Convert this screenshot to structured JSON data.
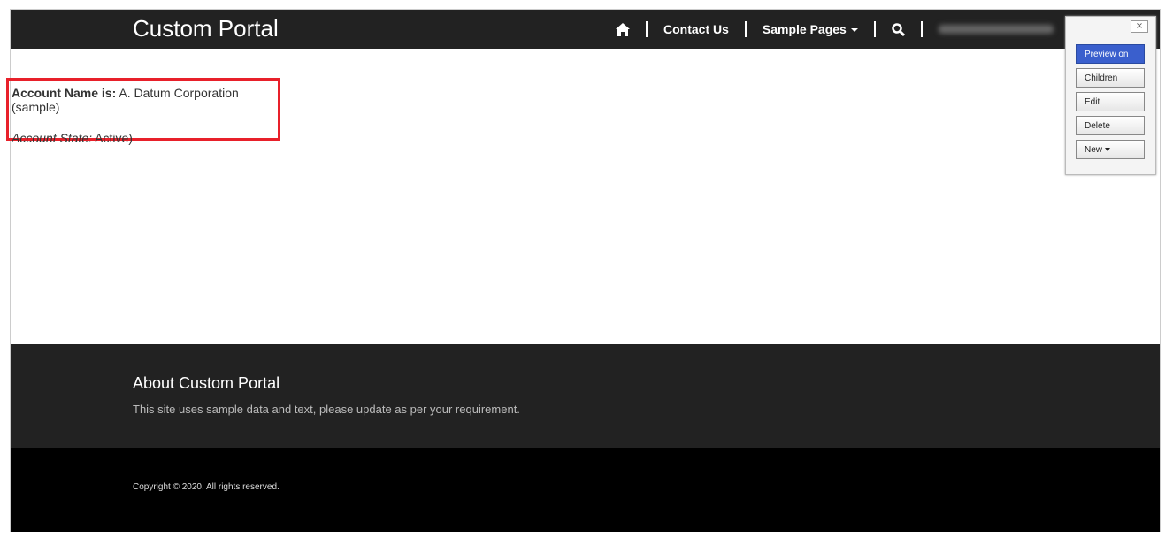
{
  "header": {
    "brand": "Custom Portal",
    "nav": {
      "home_icon": "home-icon",
      "contact": "Contact Us",
      "sample_pages": "Sample Pages",
      "search_icon": "search-icon"
    }
  },
  "content": {
    "account_name_label": "Account Name is:",
    "account_name_value": " A. Datum Corporation (sample)",
    "account_state_label": "Account State:",
    "account_state_value": " Active)",
    "highlight_color": "#e8202a"
  },
  "footer": {
    "title": "About Custom Portal",
    "text": "This site uses sample data and text, please update as per your requirement.",
    "copyright": "Copyright © 2020. All rights reserved."
  },
  "panel": {
    "close": "×",
    "preview": "Preview on",
    "children": "Children",
    "edit": "Edit",
    "delete": "Delete",
    "new": "New",
    "accent": "#3a5fcd"
  }
}
